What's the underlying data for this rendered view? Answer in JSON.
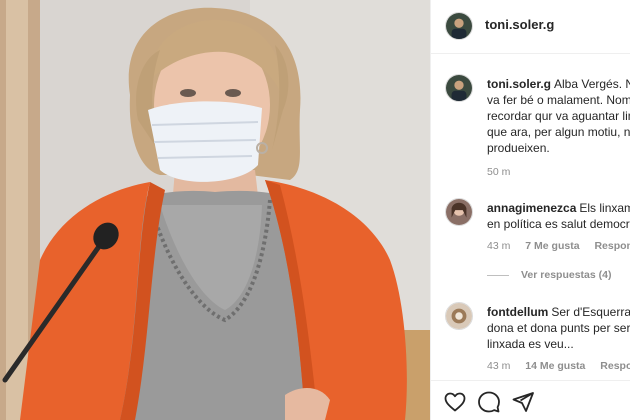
{
  "post": {
    "username": "toni.soler.g",
    "caption_username": "toni.soler.g",
    "caption_lines": [
      "Alba Vergés. No",
      "va fer bé o malament. Nom",
      "recordar qur va aguantar lin",
      "que ara, per algun motiu, no",
      "produeixen."
    ],
    "caption_time": "50 m"
  },
  "comments": [
    {
      "username": "annagimenezca",
      "lines": [
        "Els linxame",
        "en política es salut democrà"
      ],
      "time": "43 m",
      "likes": "7 Me gusta",
      "reply": "Responder",
      "view_replies": "Ver respuestas (4)"
    },
    {
      "username": "fontdellum",
      "lines": [
        "Ser d'Esquerra i",
        "dona et dona punts per ser",
        "linxada es veu..."
      ],
      "time": "43 m",
      "likes": "14 Me gusta",
      "reply": "Responder"
    }
  ],
  "actions": {
    "like_icon": "heart-icon",
    "comment_icon": "comment-icon",
    "share_icon": "share-icon"
  },
  "colors": {
    "text": "#262626",
    "secondary": "#8e8e8e",
    "border": "#efefef",
    "jacket": "#e8622c"
  }
}
